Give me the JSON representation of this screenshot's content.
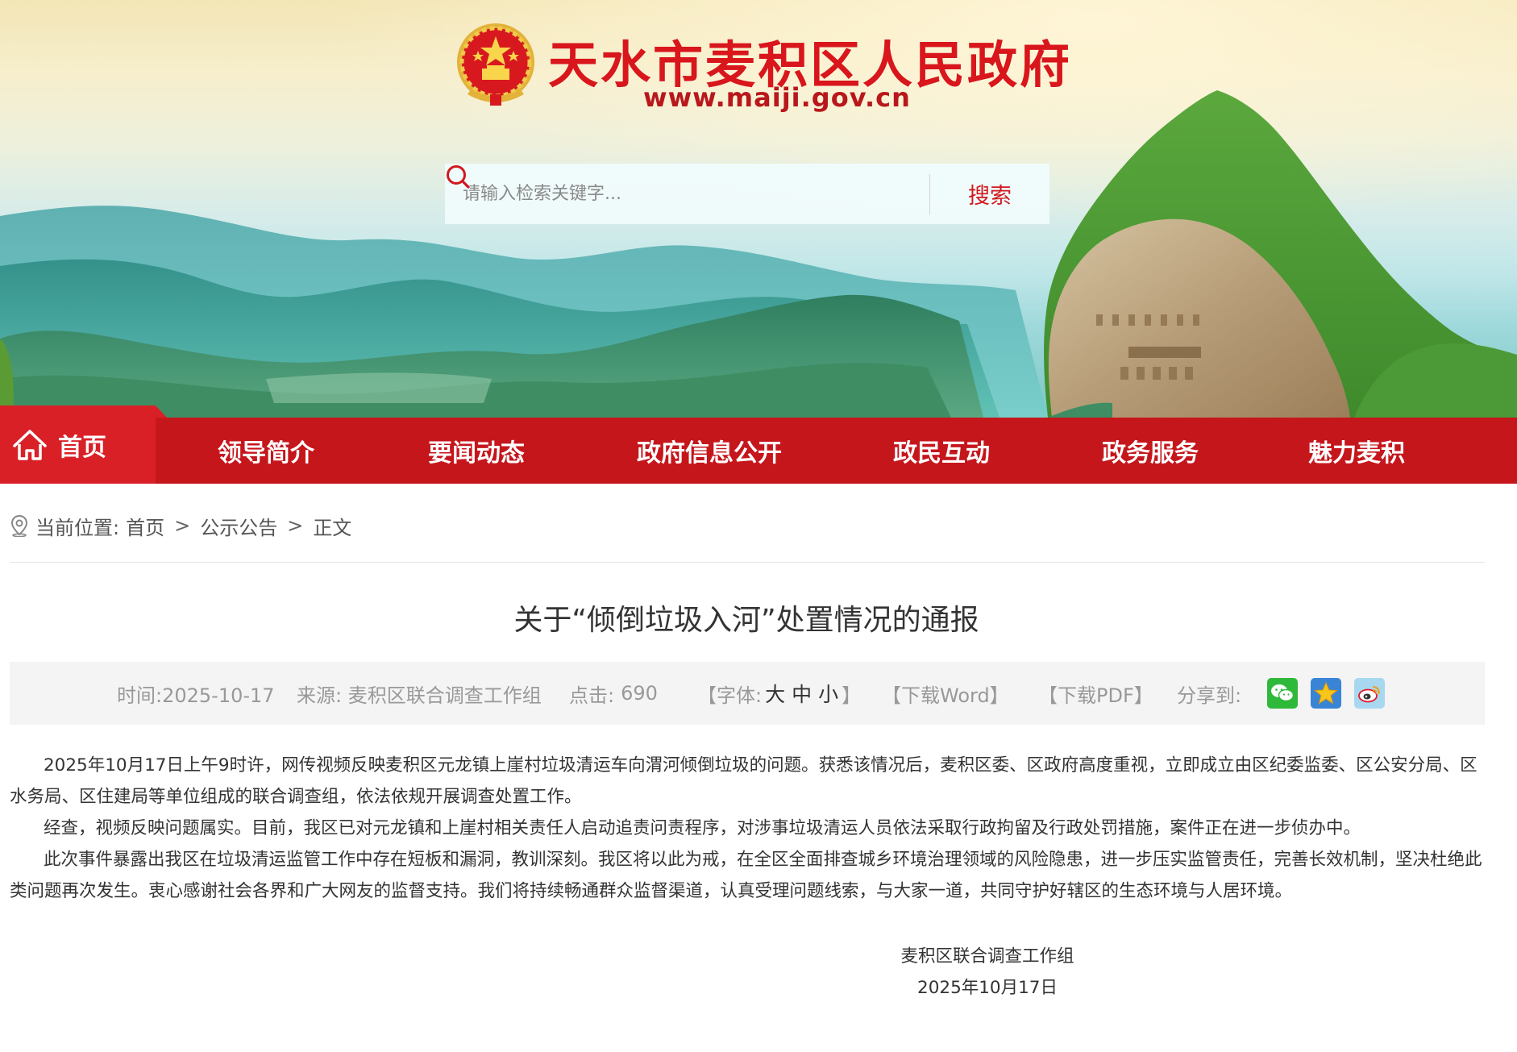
{
  "header": {
    "site_title": "天水市麦积区人民政府",
    "site_url": "www.maiji.gov.cn",
    "search": {
      "placeholder": "请输入检索关键字...",
      "button_label": "搜索"
    }
  },
  "nav": {
    "home": "首页",
    "items": [
      "领导简介",
      "要闻动态",
      "政府信息公开",
      "政民互动",
      "政务服务",
      "魅力麦积"
    ]
  },
  "breadcrumb": {
    "label": "当前位置:",
    "items": [
      "首页",
      "公示公告",
      "正文"
    ],
    "separator": ">"
  },
  "article": {
    "title": "关于“倾倒垃圾入河”处置情况的通报",
    "meta": {
      "time": "时间:2025-10-17",
      "source": "来源: 麦积区联合调查工作组",
      "clicks_label": "点击:",
      "clicks": "690",
      "font_open": "【字体:",
      "font_sizes": [
        "大",
        "中",
        "小"
      ],
      "font_close": "】",
      "download_word": "【下载Word】",
      "download_pdf": "【下载PDF】",
      "share_label": "分享到:",
      "share_icons": [
        "wechat-icon",
        "qzone-star-icon",
        "weibo-icon"
      ]
    },
    "paragraphs": [
      "2025年10月17日上午9时许，网传视频反映麦积区元龙镇上崖村垃圾清运车向渭河倾倒垃圾的问题。获悉该情况后，麦积区委、区政府高度重视，立即成立由区纪委监委、区公安分局、区水务局、区住建局等单位组成的联合调查组，依法依规开展调查处置工作。",
      "经查，视频反映问题属实。目前，我区已对元龙镇和上崖村相关责任人启动追责问责程序，对涉事垃圾清运人员依法采取行政拘留及行政处罚措施，案件正在进一步侦办中。",
      "此次事件暴露出我区在垃圾清运监管工作中存在短板和漏洞，教训深刻。我区将以此为戒，在全区全面排查城乡环境治理领域的风险隐患，进一步压实监管责任，完善长效机制，坚决杜绝此类问题再次发生。衷心感谢社会各界和广大网友的监督支持。我们将持续畅通群众监督渠道，认真受理问题线索，与大家一道，共同守护好辖区的生态环境与人居环境。"
    ],
    "signature": {
      "org": "麦积区联合调查工作组",
      "date": "2025年10月17日"
    }
  },
  "colors": {
    "brand_red": "#c5161c",
    "home_red": "#d92027",
    "title_red": "#d8161b",
    "meta_bg": "#f4f4f4"
  }
}
